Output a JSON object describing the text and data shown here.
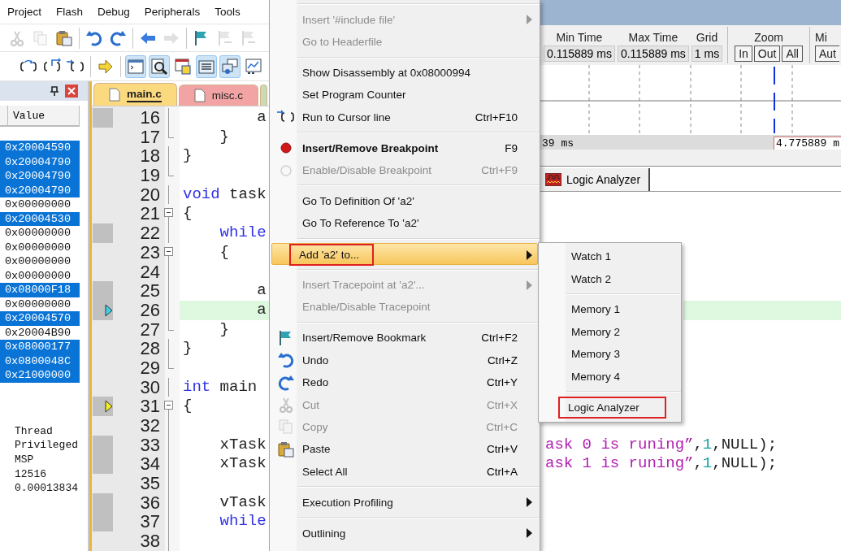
{
  "menubar": [
    "Project",
    "Flash",
    "Debug",
    "Peripherals",
    "Tools"
  ],
  "toolbar_1": [
    {
      "kind": "cut",
      "disabled": true
    },
    {
      "kind": "copy",
      "disabled": true
    },
    {
      "kind": "paste",
      "disabled": false
    },
    {
      "kind": "separator"
    },
    {
      "kind": "undo",
      "disabled": false
    },
    {
      "kind": "redo",
      "disabled": false
    },
    {
      "kind": "separator"
    },
    {
      "kind": "back",
      "disabled": false
    },
    {
      "kind": "forward",
      "disabled": true
    },
    {
      "kind": "separator"
    },
    {
      "kind": "flag",
      "disabled": false
    },
    {
      "kind": "flag-prev",
      "disabled": true
    },
    {
      "kind": "flag-next",
      "disabled": true
    }
  ],
  "toolbar_2": [
    {
      "kind": "step-over",
      "on": false
    },
    {
      "kind": "step-out",
      "on": false
    },
    {
      "kind": "run-to-cursor",
      "on": false
    },
    {
      "kind": "separator"
    },
    {
      "kind": "show-next",
      "on": false
    },
    {
      "kind": "separator"
    },
    {
      "kind": "command",
      "on": true
    },
    {
      "kind": "disassembly",
      "on": true
    },
    {
      "kind": "symbols",
      "on": false
    },
    {
      "kind": "registers",
      "on": true
    },
    {
      "kind": "call-stack",
      "on": true
    },
    {
      "kind": "watch",
      "on": false
    }
  ],
  "registers": {
    "columns": [
      "Value"
    ],
    "rows": [
      {
        "value": "0x20004590",
        "selected": true
      },
      {
        "value": "0x20004790",
        "selected": true
      },
      {
        "value": "0x20004790",
        "selected": true
      },
      {
        "value": "0x20004790",
        "selected": true
      },
      {
        "value": "0x00000000",
        "selected": false
      },
      {
        "value": "0x20004530",
        "selected": true
      },
      {
        "value": "0x00000000",
        "selected": false
      },
      {
        "value": "0x00000000",
        "selected": false
      },
      {
        "value": "0x00000000",
        "selected": false
      },
      {
        "value": "0x00000000",
        "selected": false
      },
      {
        "value": "0x08000F18",
        "selected": true
      },
      {
        "value": "0x00000000",
        "selected": false
      },
      {
        "value": "0x20004570",
        "selected": true
      },
      {
        "value": "0x20004B90",
        "selected": false
      },
      {
        "value": "0x08000177",
        "selected": true
      },
      {
        "value": "0x0800048C",
        "selected": true
      },
      {
        "value": "0x21000000",
        "selected": true
      }
    ],
    "info": [
      "Thread",
      "Privileged",
      "MSP",
      "12516",
      "0.00013834"
    ]
  },
  "editor": {
    "tabs": [
      {
        "label": "main.c",
        "selected": true,
        "color": "#fbd97f"
      },
      {
        "label": "misc.c",
        "selected": false,
        "color": "#f2a3a3"
      },
      {
        "selected": false,
        "color": "#c9dbb3"
      }
    ],
    "lines": [
      {
        "number": "16",
        "executable": true,
        "code": [
          {
            "kind": "plain",
            "text": "        a"
          }
        ]
      },
      {
        "number": "17",
        "block_end": true,
        "code": [
          {
            "kind": "plain",
            "text": "    }"
          }
        ]
      },
      {
        "number": "18",
        "code": [
          {
            "kind": "plain",
            "text": "}"
          }
        ]
      },
      {
        "number": "19",
        "block_end": true
      },
      {
        "number": "20",
        "code": [
          {
            "kind": "keyword",
            "text": "void"
          },
          {
            "kind": "plain",
            "text": " task"
          }
        ]
      },
      {
        "number": "21",
        "foldable": true,
        "code": [
          {
            "kind": "plain",
            "text": "{"
          }
        ]
      },
      {
        "number": "22",
        "executable": true,
        "code": [
          {
            "kind": "keyword",
            "text": "    while"
          }
        ]
      },
      {
        "number": "23",
        "foldable": true,
        "code": [
          {
            "kind": "plain",
            "text": "    {"
          }
        ]
      },
      {
        "number": "24"
      },
      {
        "number": "25",
        "executable": true,
        "code": [
          {
            "kind": "plain",
            "text": "        a"
          }
        ]
      },
      {
        "number": "26",
        "executable": true,
        "cursor": true,
        "highlighted": true,
        "code": [
          {
            "kind": "plain",
            "text": "        a"
          }
        ]
      },
      {
        "number": "27",
        "block_end": true,
        "code": [
          {
            "kind": "plain",
            "text": "    }"
          }
        ]
      },
      {
        "number": "28",
        "code": [
          {
            "kind": "plain",
            "text": "}"
          }
        ]
      },
      {
        "number": "29",
        "block_end": true
      },
      {
        "number": "30",
        "code": [
          {
            "kind": "keyword",
            "text": "int"
          },
          {
            "kind": "plain",
            "text": " main"
          }
        ]
      },
      {
        "number": "31",
        "executable": true,
        "current": true,
        "foldable": true,
        "code": [
          {
            "kind": "plain",
            "text": "{"
          }
        ]
      },
      {
        "number": "32"
      },
      {
        "number": "33",
        "executable": true,
        "code": [
          {
            "kind": "plain",
            "text": "    xTask"
          }
        ],
        "code_right": [
          {
            "kind": "string",
            "text": "ask 0 is runing”"
          },
          {
            "kind": "plain",
            "text": ","
          },
          {
            "kind": "number",
            "text": "1"
          },
          {
            "kind": "plain",
            "text": ",NULL);"
          }
        ]
      },
      {
        "number": "34",
        "executable": true,
        "code": [
          {
            "kind": "plain",
            "text": "    xTask"
          }
        ],
        "code_right": [
          {
            "kind": "string",
            "text": "ask 1 is runing”"
          },
          {
            "kind": "plain",
            "text": ","
          },
          {
            "kind": "number",
            "text": "1"
          },
          {
            "kind": "plain",
            "text": ",NULL);"
          }
        ]
      },
      {
        "number": "35"
      },
      {
        "number": "36",
        "executable": true,
        "code": [
          {
            "kind": "plain",
            "text": "    vTask"
          }
        ]
      },
      {
        "number": "37",
        "executable": true,
        "code": [
          {
            "kind": "keyword",
            "text": "    while"
          }
        ]
      },
      {
        "number": "38"
      }
    ]
  },
  "logic_analyzer": {
    "fields": [
      {
        "label": "Min Time",
        "value": "0.115889 ms"
      },
      {
        "label": "Max Time",
        "value": "0.115889 ms"
      },
      {
        "label": "Grid",
        "value": "1 ms"
      }
    ],
    "zoom": {
      "label": "Zoom",
      "buttons": [
        "In",
        "Out",
        "All"
      ]
    },
    "min": {
      "label": "Mi",
      "button": "Aut"
    },
    "cursor_start": "39 ms",
    "cursor_field": "4.775889 m",
    "tab": "Logic Analyzer"
  },
  "context_menu": {
    "items": [
      {
        "kind": "separator"
      },
      {
        "kind": "item",
        "label": "Insert '#include file'",
        "disabled": true,
        "submenu": true
      },
      {
        "kind": "item",
        "label": "Go to Headerfile",
        "disabled": true
      },
      {
        "kind": "separator"
      },
      {
        "kind": "item",
        "label": "Show Disassembly at 0x08000994",
        "disabled": false
      },
      {
        "kind": "item",
        "label": "Set Program Counter",
        "disabled": false
      },
      {
        "kind": "item",
        "label": "Run to Cursor line",
        "shortcut": "Ctrl+F10",
        "disabled": false
      },
      {
        "kind": "separator"
      },
      {
        "kind": "item",
        "label": "Insert/Remove Breakpoint",
        "shortcut": "F9",
        "bold": true,
        "disabled": false
      },
      {
        "kind": "item",
        "label": "Enable/Disable Breakpoint",
        "shortcut": "Ctrl+F9",
        "disabled": true
      },
      {
        "kind": "separator"
      },
      {
        "kind": "item",
        "label": "Go To Definition Of 'a2'",
        "disabled": false
      },
      {
        "kind": "item",
        "label": "Go To Reference To 'a2'",
        "disabled": false
      },
      {
        "kind": "separator"
      },
      {
        "kind": "item",
        "label": "Add 'a2' to...",
        "submenu": true,
        "selected": true,
        "annotated": true,
        "disabled": false
      },
      {
        "kind": "separator"
      },
      {
        "kind": "item",
        "label": "Insert Tracepoint at 'a2'...",
        "submenu": true,
        "disabled": true
      },
      {
        "kind": "item",
        "label": "Enable/Disable Tracepoint",
        "disabled": true
      },
      {
        "kind": "separator"
      },
      {
        "kind": "item",
        "label": "Insert/Remove Bookmark",
        "shortcut": "Ctrl+F2",
        "disabled": false
      },
      {
        "kind": "item",
        "label": "Undo",
        "shortcut": "Ctrl+Z",
        "disabled": false
      },
      {
        "kind": "item",
        "label": "Redo",
        "shortcut": "Ctrl+Y",
        "disabled": false
      },
      {
        "kind": "item",
        "label": "Cut",
        "shortcut": "Ctrl+X",
        "disabled": true
      },
      {
        "kind": "item",
        "label": "Copy",
        "shortcut": "Ctrl+C",
        "disabled": true
      },
      {
        "kind": "item",
        "label": "Paste",
        "shortcut": "Ctrl+V",
        "disabled": false
      },
      {
        "kind": "item",
        "label": "Select All",
        "shortcut": "Ctrl+A",
        "disabled": false
      },
      {
        "kind": "separator"
      },
      {
        "kind": "item",
        "label": "Execution Profiling",
        "submenu": true,
        "disabled": false
      },
      {
        "kind": "separator"
      },
      {
        "kind": "item",
        "label": "Outlining",
        "submenu": true,
        "disabled": false
      }
    ]
  },
  "submenu": {
    "items": [
      {
        "kind": "item",
        "label": "Watch 1"
      },
      {
        "kind": "item",
        "label": "Watch 2"
      },
      {
        "kind": "separator"
      },
      {
        "kind": "item",
        "label": "Memory 1"
      },
      {
        "kind": "item",
        "label": "Memory 2"
      },
      {
        "kind": "item",
        "label": "Memory 3"
      },
      {
        "kind": "item",
        "label": "Memory 4"
      },
      {
        "kind": "separator"
      },
      {
        "kind": "item",
        "label": "Logic Analyzer",
        "annotated": true
      }
    ]
  }
}
